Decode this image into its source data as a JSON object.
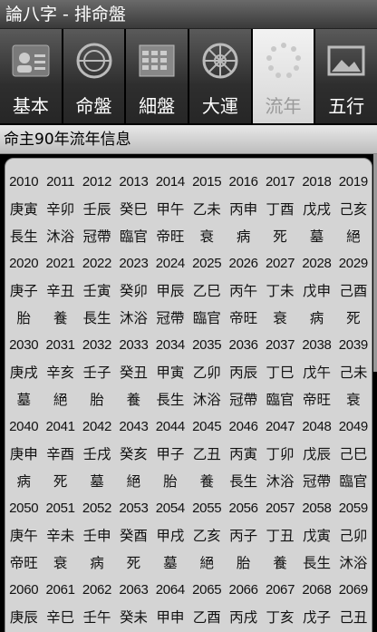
{
  "title": "論八字 - 排命盤",
  "tabs": [
    {
      "label": "基本",
      "icon": "person-card-icon",
      "active": false
    },
    {
      "label": "命盤",
      "icon": "compass-icon",
      "active": false
    },
    {
      "label": "細盤",
      "icon": "calendar-grid-icon",
      "active": false
    },
    {
      "label": "大運",
      "icon": "dharma-wheel-icon",
      "active": false
    },
    {
      "label": "流年",
      "icon": "loading-dots-icon",
      "active": true
    },
    {
      "label": "五行",
      "icon": "landscape-icon",
      "active": false
    }
  ],
  "subheader": "命主90年流年信息",
  "grid": [
    {
      "years": [
        "2010",
        "2011",
        "2012",
        "2013",
        "2014",
        "2015",
        "2016",
        "2017",
        "2018",
        "2019"
      ],
      "ganzhi": [
        "庚寅",
        "辛卯",
        "壬辰",
        "癸巳",
        "甲午",
        "乙未",
        "丙申",
        "丁酉",
        "戊戌",
        "己亥"
      ],
      "phase": [
        "長生",
        "沐浴",
        "冠帶",
        "臨官",
        "帝旺",
        "衰",
        "病",
        "死",
        "墓",
        "絕"
      ]
    },
    {
      "years": [
        "2020",
        "2021",
        "2022",
        "2023",
        "2024",
        "2025",
        "2026",
        "2027",
        "2028",
        "2029"
      ],
      "ganzhi": [
        "庚子",
        "辛丑",
        "壬寅",
        "癸卯",
        "甲辰",
        "乙巳",
        "丙午",
        "丁未",
        "戊申",
        "己酉"
      ],
      "phase": [
        "胎",
        "養",
        "長生",
        "沐浴",
        "冠帶",
        "臨官",
        "帝旺",
        "衰",
        "病",
        "死"
      ]
    },
    {
      "years": [
        "2030",
        "2031",
        "2032",
        "2033",
        "2034",
        "2035",
        "2036",
        "2037",
        "2038",
        "2039"
      ],
      "ganzhi": [
        "庚戌",
        "辛亥",
        "壬子",
        "癸丑",
        "甲寅",
        "乙卯",
        "丙辰",
        "丁巳",
        "戊午",
        "己未"
      ],
      "phase": [
        "墓",
        "絕",
        "胎",
        "養",
        "長生",
        "沐浴",
        "冠帶",
        "臨官",
        "帝旺",
        "衰"
      ]
    },
    {
      "years": [
        "2040",
        "2041",
        "2042",
        "2043",
        "2044",
        "2045",
        "2046",
        "2047",
        "2048",
        "2049"
      ],
      "ganzhi": [
        "庚申",
        "辛酉",
        "壬戌",
        "癸亥",
        "甲子",
        "乙丑",
        "丙寅",
        "丁卯",
        "戊辰",
        "己巳"
      ],
      "phase": [
        "病",
        "死",
        "墓",
        "絕",
        "胎",
        "養",
        "長生",
        "沐浴",
        "冠帶",
        "臨官"
      ]
    },
    {
      "years": [
        "2050",
        "2051",
        "2052",
        "2053",
        "2054",
        "2055",
        "2056",
        "2057",
        "2058",
        "2059"
      ],
      "ganzhi": [
        "庚午",
        "辛未",
        "壬申",
        "癸酉",
        "甲戌",
        "乙亥",
        "丙子",
        "丁丑",
        "戊寅",
        "己卯"
      ],
      "phase": [
        "帝旺",
        "衰",
        "病",
        "死",
        "墓",
        "絕",
        "胎",
        "養",
        "長生",
        "沐浴"
      ]
    },
    {
      "years": [
        "2060",
        "2061",
        "2062",
        "2063",
        "2064",
        "2065",
        "2066",
        "2067",
        "2068",
        "2069"
      ],
      "ganzhi": [
        "庚辰",
        "辛巳",
        "壬午",
        "癸未",
        "甲申",
        "乙酉",
        "丙戌",
        "丁亥",
        "戊子",
        "己丑"
      ],
      "phase": []
    }
  ],
  "colors": {
    "panel": "#d4d4d4",
    "tab_active": "#e6e6e6",
    "tab_inactive": "#3a3a3a"
  }
}
